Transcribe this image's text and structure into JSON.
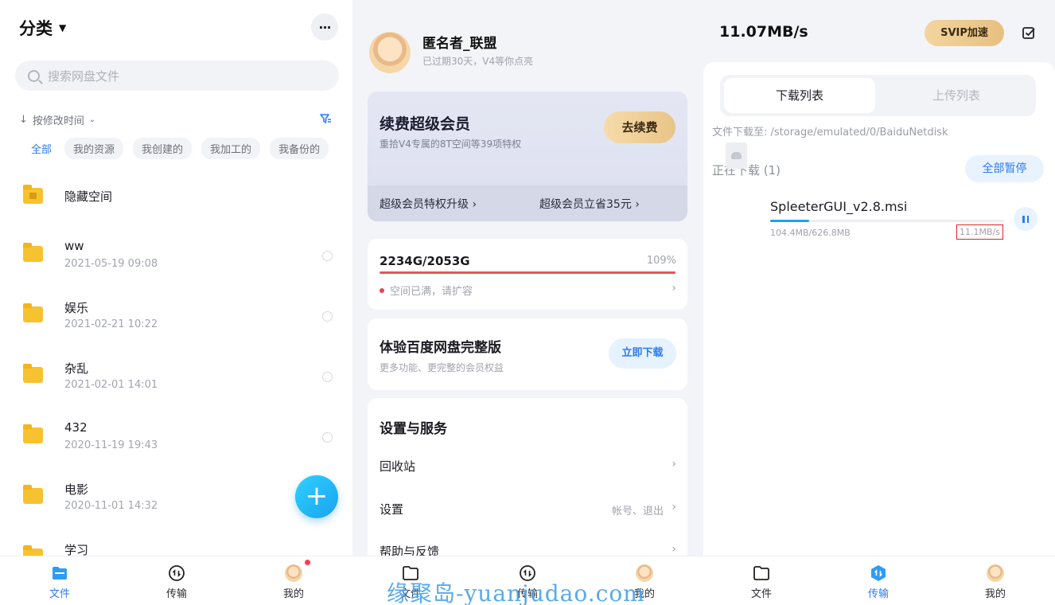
{
  "files_panel": {
    "title": "分类",
    "search_placeholder": "搜索网盘文件",
    "sort_label": "按修改时间",
    "chips": [
      "全部",
      "我的资源",
      "我创建的",
      "我加工的",
      "我备份的"
    ],
    "hidden_space": "隐藏空间",
    "folders": [
      {
        "name": "ww",
        "date": "2021-05-19  09:08"
      },
      {
        "name": "娱乐",
        "date": "2021-02-21  10:22"
      },
      {
        "name": "杂乱",
        "date": "2021-02-01  14:01"
      },
      {
        "name": "432",
        "date": "2020-11-19  19:43"
      },
      {
        "name": "电影",
        "date": "2020-11-01  14:32"
      },
      {
        "name": "学习",
        "date": ""
      }
    ],
    "fab": "+"
  },
  "tabs": {
    "files": "文件",
    "transfer": "传输",
    "me": "我的"
  },
  "me_panel": {
    "username": "匿名者_联盟",
    "status": "已过期30天，V4等你点亮",
    "vip_title": "续费超级会员",
    "vip_sub": "重拾V4专属的8T空间等39项特权",
    "renew_button": "去续费",
    "vip_link1": "超级会员特权升级",
    "vip_link2": "超级会员立省35元",
    "storage": "2234G/2053G",
    "storage_pct": "109%",
    "storage_used_fraction": 1.0,
    "storage_warning": "空间已满，请扩容",
    "trial_title": "体验百度网盘完整版",
    "trial_sub": "更多功能、更完整的会员权益",
    "download_button": "立即下载",
    "services_title": "设置与服务",
    "recycle": "回收站",
    "settings": "设置",
    "settings_extra": "帐号、退出",
    "help": "帮助与反馈"
  },
  "transfer_panel": {
    "speed": "11.07MB/s",
    "svip_button": "SVIP加速",
    "tab_download": "下载列表",
    "tab_upload": "上传列表",
    "path": "文件下载至: /storage/emulated/0/BaiduNetdisk",
    "downloading": "正在下载 (1)",
    "pause_all": "全部暂停",
    "file": {
      "name": "SpleeterGUI_v2.8.msi",
      "size": "104.4MB/626.8MB",
      "speed": "11.1MB/s",
      "progress": 0.167
    }
  },
  "watermark": "缘聚岛-yuanjudao.com",
  "colors": {
    "accent": "#2d7bf5",
    "folder": "#f7c22f",
    "warning": "#e9545b",
    "gold": "#e8c487"
  }
}
